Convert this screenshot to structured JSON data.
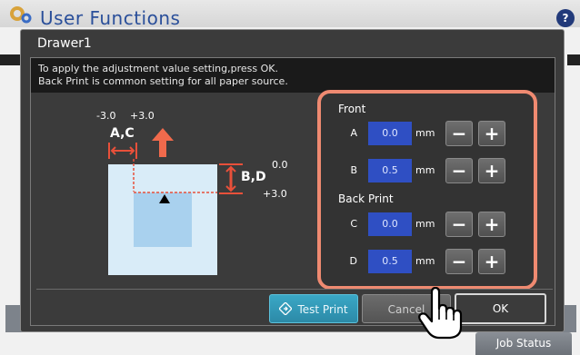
{
  "app": {
    "title": "User Functions",
    "help_label": "?",
    "job_status_label": "Job Status",
    "accent_color": "#2f4fc3",
    "highlight_color": "#ef8a71"
  },
  "dialog": {
    "title": "Drawer1",
    "message_lines": [
      "To apply the adjustment value setting,press OK.",
      "Back Print is common setting for all paper source."
    ]
  },
  "diagram": {
    "range_min_h": "-3.0",
    "range_max_h": "+3.0",
    "label_ac": "A,C",
    "label_bd": "B,D",
    "range_min_v": "0.0",
    "range_max_v": "+3.0"
  },
  "adjustments": {
    "front_label": "Front",
    "back_label": "Back Print",
    "rows": [
      {
        "label": "A",
        "value": "0.0",
        "unit": "mm",
        "minus": "−",
        "plus": "+"
      },
      {
        "label": "B",
        "value": "0.5",
        "unit": "mm",
        "minus": "−",
        "plus": "+"
      },
      {
        "label": "C",
        "value": "0.0",
        "unit": "mm",
        "minus": "−",
        "plus": "+"
      },
      {
        "label": "D",
        "value": "0.5",
        "unit": "mm",
        "minus": "−",
        "plus": "+"
      }
    ]
  },
  "buttons": {
    "test_print": "Test Print",
    "cancel": "Cancel",
    "ok": "OK"
  },
  "icons": {
    "gear": "gear-icon",
    "help": "help-icon",
    "test_print": "diamond-arrow-icon",
    "cursor": "hand-pointer-icon"
  }
}
